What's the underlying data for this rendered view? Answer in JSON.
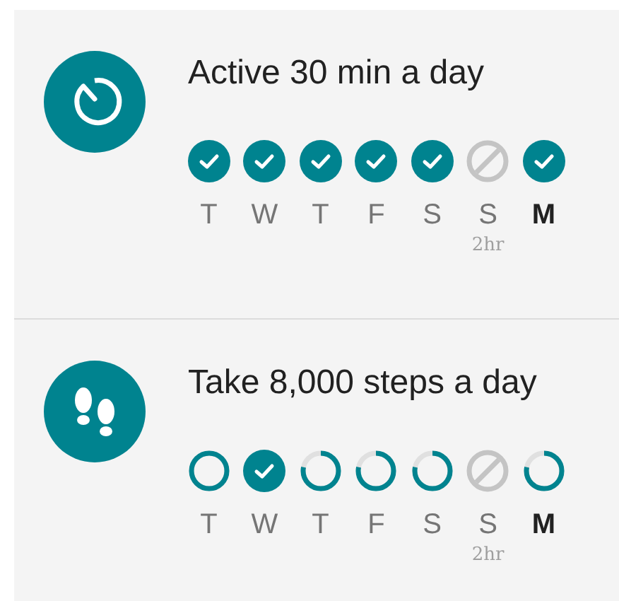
{
  "goals": [
    {
      "title": "Active 30 min a day",
      "days": [
        {
          "label": "T",
          "kind": "done",
          "today": false
        },
        {
          "label": "W",
          "kind": "done",
          "today": false
        },
        {
          "label": "T",
          "kind": "done",
          "today": false
        },
        {
          "label": "F",
          "kind": "done",
          "today": false
        },
        {
          "label": "S",
          "kind": "done",
          "today": false
        },
        {
          "label": "S",
          "kind": "skipped",
          "today": false,
          "note": "2hr"
        },
        {
          "label": "M",
          "kind": "done",
          "today": true
        }
      ]
    },
    {
      "title": "Take 8,000 steps a day",
      "days": [
        {
          "label": "T",
          "kind": "ring",
          "today": false
        },
        {
          "label": "W",
          "kind": "done",
          "today": false
        },
        {
          "label": "T",
          "kind": "partial",
          "today": false
        },
        {
          "label": "F",
          "kind": "partial",
          "today": false
        },
        {
          "label": "S",
          "kind": "partial",
          "today": false
        },
        {
          "label": "S",
          "kind": "skipped",
          "today": false,
          "note": "2hr"
        },
        {
          "label": "M",
          "kind": "partial",
          "today": true
        }
      ]
    }
  ]
}
